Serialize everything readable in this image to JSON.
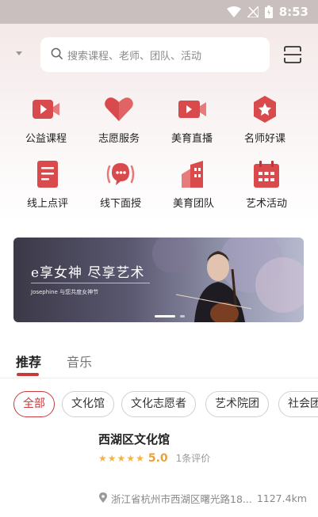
{
  "status_bar": {
    "time": "8:53"
  },
  "search": {
    "placeholder": "搜索课程、老师、团队、活动"
  },
  "grid": [
    {
      "label": "公益课程"
    },
    {
      "label": "志愿服务"
    },
    {
      "label": "美育直播"
    },
    {
      "label": "名师好课"
    },
    {
      "label": "线上点评"
    },
    {
      "label": "线下面授"
    },
    {
      "label": "美育团队"
    },
    {
      "label": "艺术活动"
    }
  ],
  "banner": {
    "title": "e享女神 尽享艺术",
    "subtitle": "Josephine 与您共度女神节"
  },
  "tabs": [
    {
      "label": "推荐"
    },
    {
      "label": "音乐"
    }
  ],
  "chips": [
    {
      "label": "全部"
    },
    {
      "label": "文化馆"
    },
    {
      "label": "文化志愿者"
    },
    {
      "label": "艺术院团"
    },
    {
      "label": "社会团"
    }
  ],
  "venue": {
    "name": "西湖区文化馆",
    "score": "5.0",
    "rating_stars": 5,
    "reviews": "1条评价",
    "address": "浙江省杭州市西湖区曙光路18...",
    "distance": "1127.4km"
  },
  "colors": {
    "accent": "#c83a3c",
    "star": "#f1b547"
  }
}
